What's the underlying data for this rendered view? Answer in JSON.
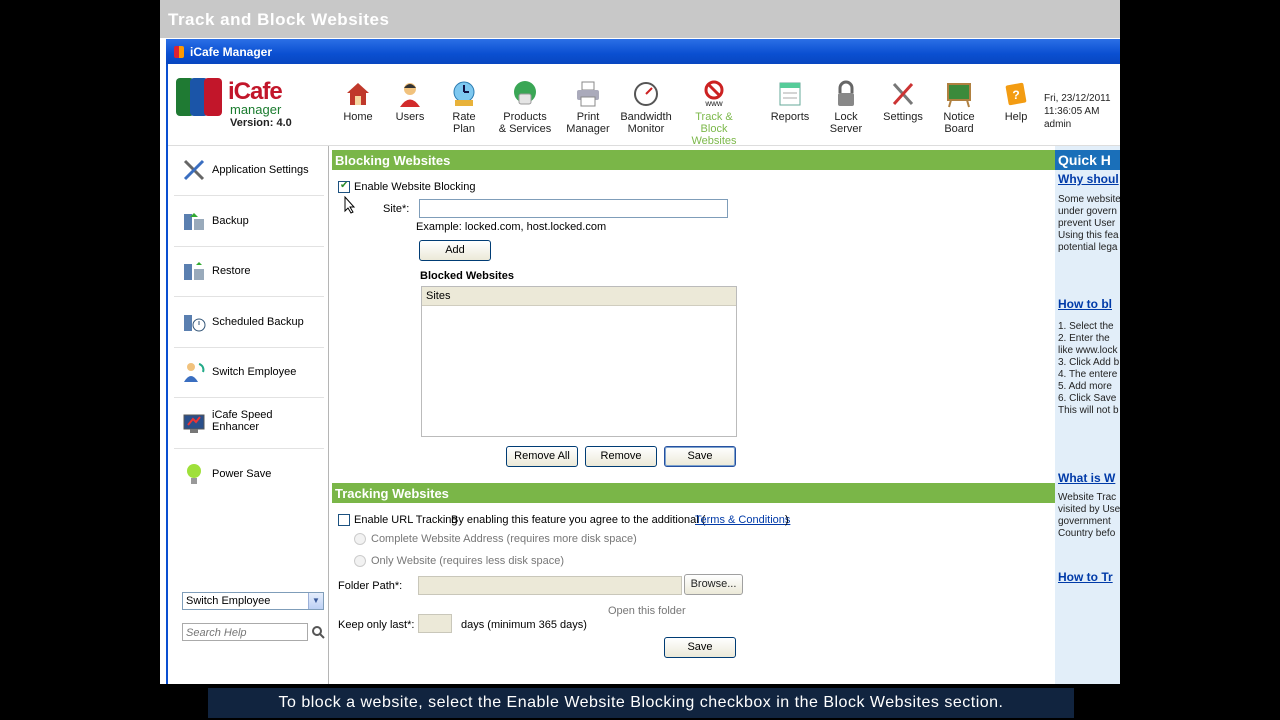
{
  "video_title": "Track and Block Websites",
  "window_title": "iCafe Manager",
  "logo": {
    "name": "iCafe",
    "subtitle": "manager",
    "version": "Version: 4.0"
  },
  "toolbar": [
    {
      "label": "Home",
      "icon": "home-icon"
    },
    {
      "label": "Users",
      "icon": "users-icon"
    },
    {
      "label": "Rate\nPlan",
      "icon": "rate-plan-icon"
    },
    {
      "label": "Products\n& Services",
      "icon": "products-icon"
    },
    {
      "label": "Print\nManager",
      "icon": "printer-icon"
    },
    {
      "label": "Bandwidth\nMonitor",
      "icon": "gauge-icon"
    },
    {
      "label": "Track &\nBlock Websites",
      "icon": "block-www-icon",
      "active": true
    },
    {
      "label": "Reports",
      "icon": "reports-icon"
    },
    {
      "label": "Lock\nServer",
      "icon": "lock-icon"
    },
    {
      "label": "Settings",
      "icon": "settings-icon"
    },
    {
      "label": "Notice\nBoard",
      "icon": "notice-board-icon"
    },
    {
      "label": "Help",
      "icon": "help-icon"
    }
  ],
  "datetime": {
    "date": "Fri, 23/12/2011",
    "time": "11:36:05 AM",
    "user": "admin"
  },
  "sidebar": {
    "items": [
      {
        "label": "Application Settings",
        "icon": "tools-icon"
      },
      {
        "label": "Backup",
        "icon": "backup-icon"
      },
      {
        "label": "Restore",
        "icon": "restore-icon"
      },
      {
        "label": "Scheduled Backup",
        "icon": "scheduled-backup-icon"
      },
      {
        "label": "Switch Employee",
        "icon": "switch-employee-icon"
      },
      {
        "label": "iCafe Speed Enhancer",
        "icon": "speed-enhancer-icon"
      },
      {
        "label": "Power Save",
        "icon": "bulb-icon"
      }
    ],
    "select_value": "Switch Employee",
    "search_placeholder": "Search Help"
  },
  "blocking": {
    "heading": "Blocking Websites",
    "enable_label": "Enable Website Blocking",
    "enabled": true,
    "site_label": "Site*:",
    "site_value": "",
    "example": "Example: locked.com, host.locked.com",
    "add_label": "Add",
    "list_title": "Blocked Websites",
    "list_header": "Sites",
    "remove_all_label": "Remove All",
    "remove_label": "Remove",
    "save_label": "Save"
  },
  "tracking": {
    "heading": "Tracking Websites",
    "enable_label": "Enable URL Tracking",
    "enabled": false,
    "agree_text": "By enabling this feature you agree to the additional (",
    "terms_label": "Terms & Conditions",
    "close_paren": ")",
    "option_complete": "Complete Website Address (requires more disk space)",
    "option_only": "Only Website (requires less disk space)",
    "folder_label": "Folder Path*:",
    "folder_value": "",
    "browse_label": "Browse...",
    "open_folder_label": "Open this folder",
    "keep_label": "Keep only last*:",
    "keep_value": "",
    "days_label": "days (minimum 365 days)",
    "save_label": "Save"
  },
  "help": {
    "heading": "Quick H",
    "link1": "Why shoul",
    "text1": [
      "Some website",
      "under govern",
      "prevent User",
      "Using this fea",
      "potential lega"
    ],
    "link2": "How to bl",
    "text2": [
      "1. Select the",
      "2. Enter the",
      "like www.lock",
      "3. Click Add b",
      "4. The entere",
      "5. Add more",
      "6. Click Save",
      "This will not b"
    ],
    "link3": "What is W",
    "text3": [
      "Website Trac",
      "visited by Use",
      "government",
      "Country befo"
    ],
    "link4": "How to Tr"
  },
  "caption": "To block a website, select the Enable Website Blocking checkbox in the Block Websites section."
}
